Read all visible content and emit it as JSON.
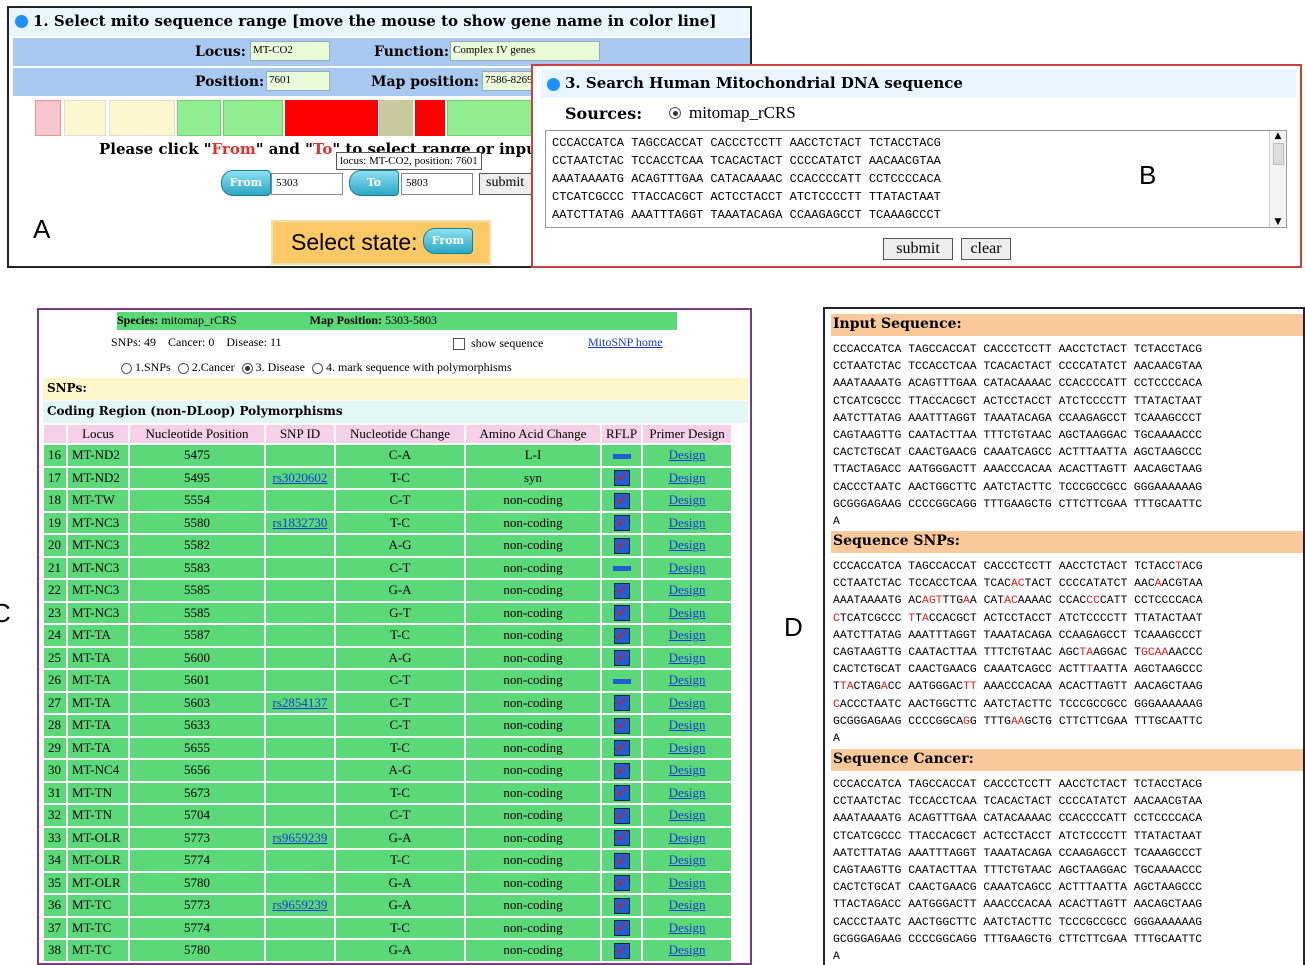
{
  "panelA": {
    "header": "1. Select mito sequence range [move the mouse to show gene name in color line]",
    "locus_label": "Locus:",
    "locus_value": "MT-CO2",
    "function_label": "Function:",
    "function_value": "Complex IV genes",
    "position_label": "Position:",
    "position_value": "7601",
    "map_position_label": "Map position:",
    "map_position_value": "7586-8269",
    "instruction_prefix": "Please click \"",
    "instruction_from": "From",
    "instruction_mid": "\" and \"",
    "instruction_to": "To",
    "instruction_suffix": "\" to  select range or input",
    "tooltip": "locus: MT-CO2, position: 7601",
    "from_button": "From",
    "from_value": "5303",
    "to_button": "To",
    "to_value": "5803",
    "submit_button": "submit",
    "select_state_label": "Select state:",
    "select_state_button": "From",
    "letter": "A",
    "color_segments": [
      "#f7c6cf",
      "#fdf7cf",
      "#fdf7cf",
      "#90ee90",
      "#90ee90",
      "#ff0000",
      "#c9c9a0",
      "#ff0000",
      "#90ee90"
    ]
  },
  "panelB": {
    "header": "3. Search Human Mitochondrial DNA sequence",
    "sources_label": "Sources:",
    "source_option": "mitomap_rCRS",
    "sequence": "CCCACCATCA TAGCCACCAT CACCCTCCTT AACCTCTACT TCTACCTACG\nCCTAATCTAC TCCACCTCAA TCACACTACT CCCCATATCT AACAACGTAA\nAAATAAAATG ACAGTTTGAA CATACAAAAC CCACCCCATT CCTCCCCACA\nCTCATCGCCC TTACCACGCT ACTCCTACCT ATCTCCCCTT TTATACTAAT\nAATCTTATAG AAATTTAGGT TAAATACAGA CCAAGAGCCT TCAAAGCCCT",
    "submit_button": "submit",
    "clear_button": "clear",
    "letter": "B"
  },
  "panelC": {
    "species_label": "Species:",
    "species_value": "mitomap_rCRS",
    "map_position_label": "Map Position:",
    "map_position_value": "5303-5803",
    "stats": "SNPs: 49    Cancer: 0    Disease: 11",
    "show_sequence": "show sequence",
    "home_link": "MitoSNP home",
    "options": [
      "1.SNPs",
      "2.Cancer",
      "3. Disease",
      "4. mark sequence with polymorphisms"
    ],
    "snps_heading": "SNPs:",
    "region_heading": "Coding Region (non-DLoop) Polymorphisms",
    "columns": [
      "Locus",
      "Nucleotide Position",
      "SNP ID",
      "Nucleotide Change",
      "Amino Acid Change",
      "RFLP",
      "Primer Design"
    ],
    "rows": [
      [
        "16",
        "MT-ND2",
        "5475",
        "",
        "C-A",
        "L-I",
        "dash",
        "Design"
      ],
      [
        "17",
        "MT-ND2",
        "5495",
        "rs3020602",
        "T-C",
        "syn",
        "check",
        "Design"
      ],
      [
        "18",
        "MT-TW",
        "5554",
        "",
        "C-T",
        "non-coding",
        "check",
        "Design"
      ],
      [
        "19",
        "MT-NC3",
        "5580",
        "rs1832730",
        "T-C",
        "non-coding",
        "check",
        "Design"
      ],
      [
        "20",
        "MT-NC3",
        "5582",
        "",
        "A-G",
        "non-coding",
        "check",
        "Design"
      ],
      [
        "21",
        "MT-NC3",
        "5583",
        "",
        "C-T",
        "non-coding",
        "dash",
        "Design"
      ],
      [
        "22",
        "MT-NC3",
        "5585",
        "",
        "G-A",
        "non-coding",
        "check",
        "Design"
      ],
      [
        "23",
        "MT-NC3",
        "5585",
        "",
        "G-T",
        "non-coding",
        "check",
        "Design"
      ],
      [
        "24",
        "MT-TA",
        "5587",
        "",
        "T-C",
        "non-coding",
        "check",
        "Design"
      ],
      [
        "25",
        "MT-TA",
        "5600",
        "",
        "A-G",
        "non-coding",
        "check",
        "Design"
      ],
      [
        "26",
        "MT-TA",
        "5601",
        "",
        "C-T",
        "non-coding",
        "dash",
        "Design"
      ],
      [
        "27",
        "MT-TA",
        "5603",
        "rs2854137",
        "C-T",
        "non-coding",
        "check",
        "Design"
      ],
      [
        "28",
        "MT-TA",
        "5633",
        "",
        "C-T",
        "non-coding",
        "check",
        "Design"
      ],
      [
        "29",
        "MT-TA",
        "5655",
        "",
        "T-C",
        "non-coding",
        "check",
        "Design"
      ],
      [
        "30",
        "MT-NC4",
        "5656",
        "",
        "A-G",
        "non-coding",
        "check",
        "Design"
      ],
      [
        "31",
        "MT-TN",
        "5673",
        "",
        "T-C",
        "non-coding",
        "check",
        "Design"
      ],
      [
        "32",
        "MT-TN",
        "5704",
        "",
        "C-T",
        "non-coding",
        "check",
        "Design"
      ],
      [
        "33",
        "MT-OLR",
        "5773",
        "rs9659239",
        "G-A",
        "non-coding",
        "check",
        "Design"
      ],
      [
        "34",
        "MT-OLR",
        "5774",
        "",
        "T-C",
        "non-coding",
        "check",
        "Design"
      ],
      [
        "35",
        "MT-OLR",
        "5780",
        "",
        "G-A",
        "non-coding",
        "check",
        "Design"
      ],
      [
        "36",
        "MT-TC",
        "5773",
        "rs9659239",
        "G-A",
        "non-coding",
        "check",
        "Design"
      ],
      [
        "37",
        "MT-TC",
        "5774",
        "",
        "T-C",
        "non-coding",
        "check",
        "Design"
      ],
      [
        "38",
        "MT-TC",
        "5780",
        "",
        "G-A",
        "non-coding",
        "check",
        "Design"
      ]
    ],
    "letter": "C"
  },
  "panelD": {
    "input_heading": "Input Sequence:",
    "snps_heading": "Sequence SNPs:",
    "cancer_heading": "Sequence Cancer:",
    "sequence_lines": [
      "CCCACCATCA TAGCCACCAT CACCCTCCTT AACCTCTACT TCTACCTACG",
      "CCTAATCTAC TCCACCTCAA TCACACTACT CCCCATATCT AACAACGTAA",
      "AAATAAAATG ACAGTTTGAA CATACAAAAC CCACCCCATT CCTCCCCACA",
      "CTCATCGCCC TTACCACGCT ACTCCTACCT ATCTCCCCTT TTATACTAAT",
      "AATCTTATAG AAATTTAGGT TAAATACAGA CCAAGAGCCT TCAAAGCCCT",
      "CAGTAAGTTG CAATACTTAA TTTCTGTAAC AGCTAAGGAC TGCAAAACCC",
      "CACTCTGCAT CAACTGAACG CAAATCAGCC ACTTTAATTA AGCTAAGCCC",
      "TTACTAGACC AATGGGACTT AAACCCACAA ACACTTAGTT AACAGCTAAG",
      "CACCCTAATC AACTGGCTTC AATCTACTTC TCCCGCCGCC GGGAAAAAAG",
      "GCGGGAGAAG CCCCGGCAGG TTTGAAGCTG CTTCTTCGAA TTTGCAATTC",
      "A"
    ],
    "letter": "D"
  }
}
